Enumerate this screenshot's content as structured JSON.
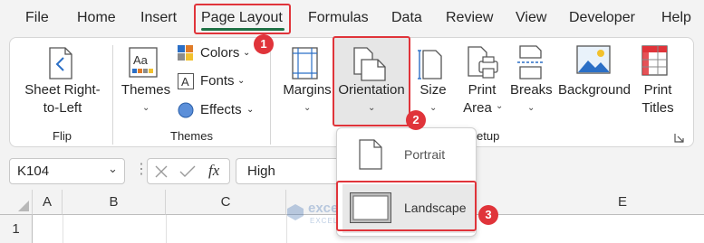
{
  "menu": {
    "tabs": [
      "File",
      "Home",
      "Insert",
      "Page Layout",
      "Formulas",
      "Data",
      "Review",
      "View",
      "Developer",
      "Help"
    ],
    "active_tab": "Page Layout"
  },
  "ribbon": {
    "flip": {
      "button_line1": "Sheet Right-",
      "button_line2": "to-Left",
      "group": "Flip"
    },
    "themes": {
      "themes_label": "Themes",
      "colors_label": "Colors",
      "fonts_label": "Fonts",
      "effects_label": "Effects",
      "group": "Themes"
    },
    "page_setup": {
      "margins_label": "Margins",
      "orientation_label": "Orientation",
      "size_label": "Size",
      "print_area_line1": "Print",
      "print_area_line2": "Area",
      "breaks_label": "Breaks",
      "background_label": "Background",
      "print_titles_line1": "Print",
      "print_titles_line2": "Titles",
      "group_partial": "etup"
    }
  },
  "formula_bar": {
    "name_box": "K104",
    "fx": "fx",
    "formula": "High"
  },
  "grid": {
    "columns": [
      "A",
      "B",
      "C",
      "E"
    ],
    "rows": [
      "1"
    ]
  },
  "orientation_menu": {
    "items": [
      "Portrait",
      "Landscape"
    ]
  },
  "watermark": {
    "brand": "exceldemy",
    "tagline": "EXCEL · DATA · BI"
  },
  "callouts": [
    "1",
    "2",
    "3"
  ],
  "colors": {
    "accent_green": "#1e7145",
    "highlight_red": "#e0343a",
    "orientation_pressed": "#e6e6e6"
  }
}
